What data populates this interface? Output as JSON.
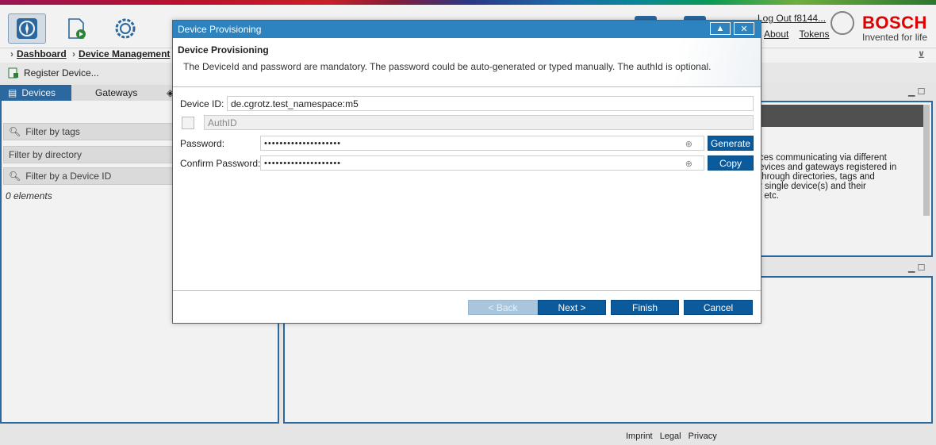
{
  "header": {
    "logout": "Log Out f8144...",
    "about": "About",
    "tokens": "Tokens",
    "brand": "BOSCH",
    "tagline": "Invented for life"
  },
  "breadcrumb": {
    "items": [
      "Dashboard",
      "Device Management"
    ]
  },
  "actions": {
    "register": "Register Device..."
  },
  "tabs": {
    "devices": "Devices",
    "gateways": "Gateways"
  },
  "filters": {
    "tags": "Filter by tags",
    "directory": "Filter by directory",
    "device_id": "Filter by a Device ID"
  },
  "list": {
    "count": "0 elements"
  },
  "info_panel": {
    "lines": [
      "ces communicating via different",
      "evices and gateways registered in",
      "through directories, tags and",
      "r single device(s) and their",
      ", etc."
    ]
  },
  "footer": {
    "imprint": "Imprint",
    "legal": "Legal",
    "privacy": "Privacy"
  },
  "dialog": {
    "window_title": "Device Provisioning",
    "heading": "Device Provisioning",
    "description": "The DeviceId and password are mandatory. The password could be auto-generated or typed manually. The authId is optional.",
    "device_id_label": "Device ID:",
    "device_id_value": "de.cgrotz.test_namespace:m5",
    "auth_id_placeholder": "AuthID",
    "password_label": "Password:",
    "password_value": "••••••••••••••••••••",
    "confirm_label": "Confirm Password:",
    "confirm_value": "••••••••••••••••••••",
    "generate": "Generate",
    "copy": "Copy",
    "back": "< Back",
    "next": "Next >",
    "finish": "Finish",
    "cancel": "Cancel"
  }
}
